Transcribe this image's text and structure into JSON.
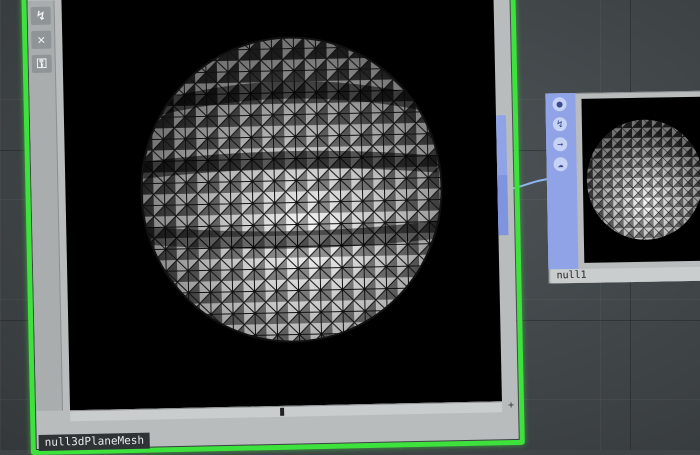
{
  "main_node": {
    "label": "null3dPlaneMesh",
    "toolbar": [
      {
        "name": "bypass-icon",
        "glyph": "↯"
      },
      {
        "name": "close-icon",
        "glyph": "✕"
      },
      {
        "name": "lock-icon",
        "glyph": "⚿"
      }
    ],
    "add_button": "+"
  },
  "second_node": {
    "label": "null1",
    "toolbar": [
      {
        "name": "circle-icon",
        "glyph": "●"
      },
      {
        "name": "bypass-icon",
        "glyph": "↯"
      },
      {
        "name": "arrow-icon",
        "glyph": "→"
      },
      {
        "name": "cloud-icon",
        "glyph": "☁"
      }
    ]
  },
  "colors": {
    "selection": "#3ee23c",
    "wire": "#8fb3f0",
    "node_accent": "#8fa3e6",
    "background": "#3f4447"
  }
}
